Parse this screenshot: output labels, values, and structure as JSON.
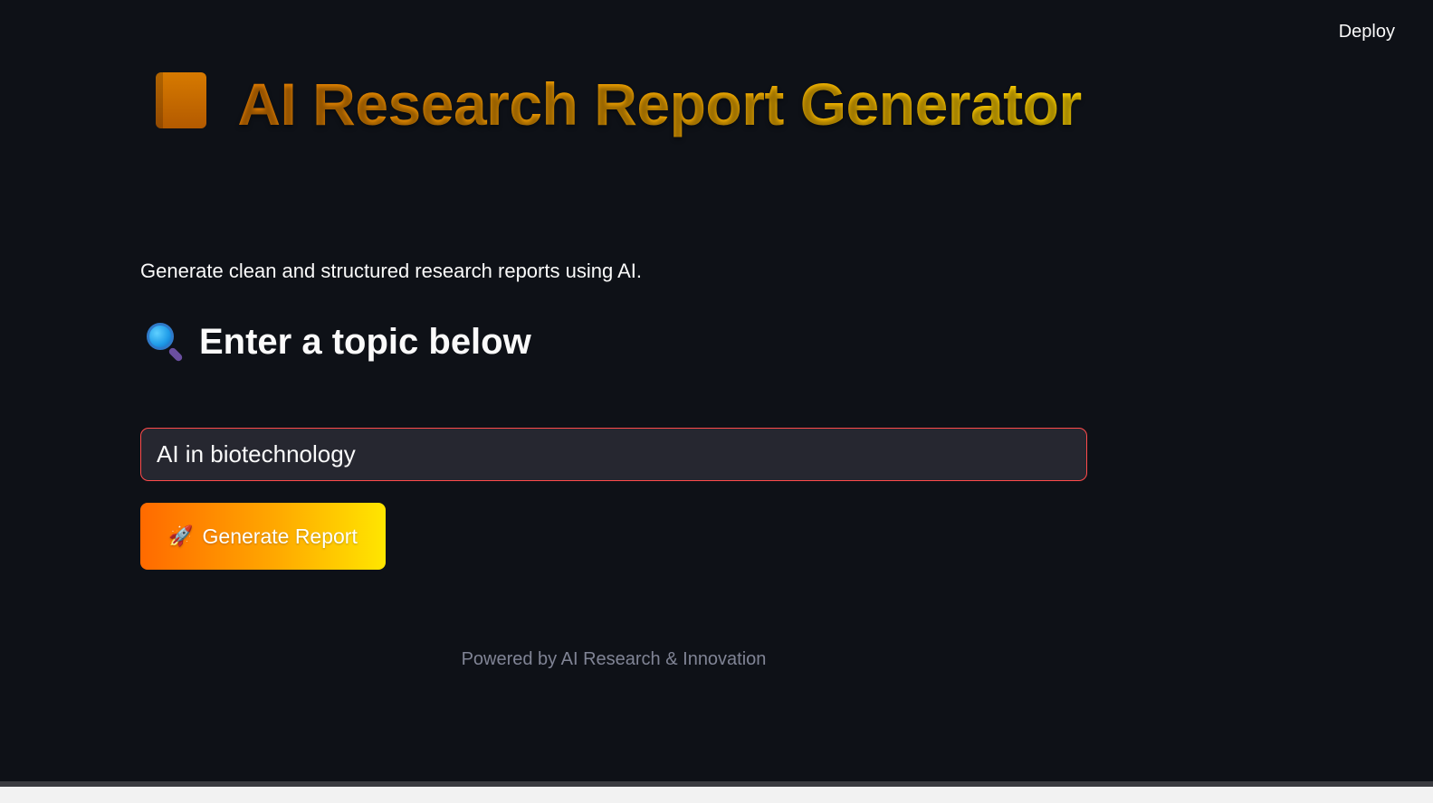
{
  "header": {
    "deploy_label": "Deploy"
  },
  "main": {
    "title": "AI Research Report Generator",
    "title_icon": "book-icon",
    "subtitle": "Generate clean and structured research reports using AI.",
    "section_heading": "Enter a topic below",
    "section_icon": "magnifier-icon",
    "topic_input": {
      "value": "AI in biotechnology"
    },
    "generate_button": {
      "label": "Generate Report",
      "icon": "rocket-icon"
    },
    "footer": "Powered by AI Research & Innovation"
  },
  "colors": {
    "background": "#0e1117",
    "accent_orange": "#ff6a00",
    "accent_yellow": "#ffe600",
    "input_border": "#ff4b4b",
    "input_bg": "#262730",
    "footer_text": "#808495"
  }
}
